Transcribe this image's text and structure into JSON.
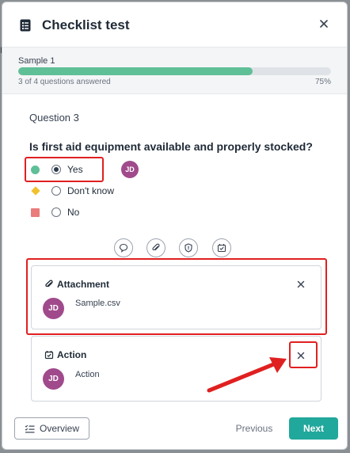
{
  "dialog": {
    "title": "Checklist test",
    "title_icon": "checklist-icon",
    "close_icon": "close-icon"
  },
  "progress": {
    "sample_label": "Sample 1",
    "answered_text": "3 of 4 questions answered",
    "percent_text": "75%",
    "fraction": 0.75,
    "fill_color": "#5fbf97"
  },
  "question": {
    "number_label": "Question 3",
    "text": "Is first aid equipment available and properly stocked?",
    "options": [
      {
        "label": "Yes",
        "marker_color": "#5fbf97",
        "marker_shape": "circle",
        "selected": true
      },
      {
        "label": "Don't know",
        "marker_color": "#f2c12e",
        "marker_shape": "diamond",
        "selected": false
      },
      {
        "label": "No",
        "marker_color": "#ea7c7c",
        "marker_shape": "square",
        "selected": false
      }
    ],
    "answer_avatar": "JD"
  },
  "tools": [
    {
      "icon": "comment-icon"
    },
    {
      "icon": "paperclip-icon"
    },
    {
      "icon": "shield-icon"
    },
    {
      "icon": "calendar-check-icon"
    }
  ],
  "attachment_card": {
    "title": "Attachment",
    "icon": "paperclip-icon",
    "avatar": "JD",
    "file_name": "Sample.csv"
  },
  "action_card": {
    "title": "Action",
    "icon": "calendar-check-icon",
    "avatar": "JD",
    "description": "Action"
  },
  "footer": {
    "overview_label": "Overview",
    "previous_label": "Previous",
    "next_label": "Next"
  },
  "colors": {
    "accent": "#21a89c",
    "avatar": "#a04a8c",
    "annotation": "#e02020"
  }
}
